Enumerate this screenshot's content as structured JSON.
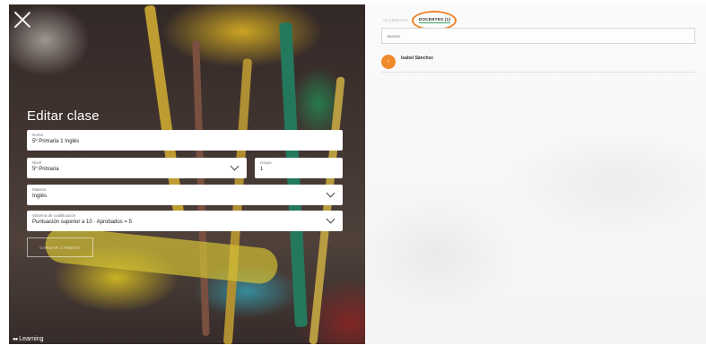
{
  "close_icon": "close-icon",
  "form": {
    "title": "Editar clase",
    "name": {
      "label": "Nome",
      "value": "5º Primaria 1 Inglés"
    },
    "level": {
      "label": "Nivel",
      "value": "5º Primaria"
    },
    "group": {
      "label": "Grupo",
      "value": "1"
    },
    "subject": {
      "label": "Materia",
      "value": "Inglés"
    },
    "grading": {
      "label": "Sistema de cualificación",
      "value": "Puntuación superior a 10 · Aprobados = 5"
    },
    "save_label": "GARDAR CAMBIOS"
  },
  "brand": {
    "name": "Learning"
  },
  "tabs": [
    {
      "label": "ALUMNADO",
      "active": false
    },
    {
      "label": "DOCENTES (1)",
      "active": true
    }
  ],
  "search": {
    "placeholder": "Buscar"
  },
  "members": [
    {
      "initial": "I",
      "name": "Isabel Sánchez"
    }
  ],
  "colors": {
    "accent_orange": "#f08a2a",
    "highlight_ring": "#f0832a",
    "active_tab_underline": "#3aa66a"
  }
}
